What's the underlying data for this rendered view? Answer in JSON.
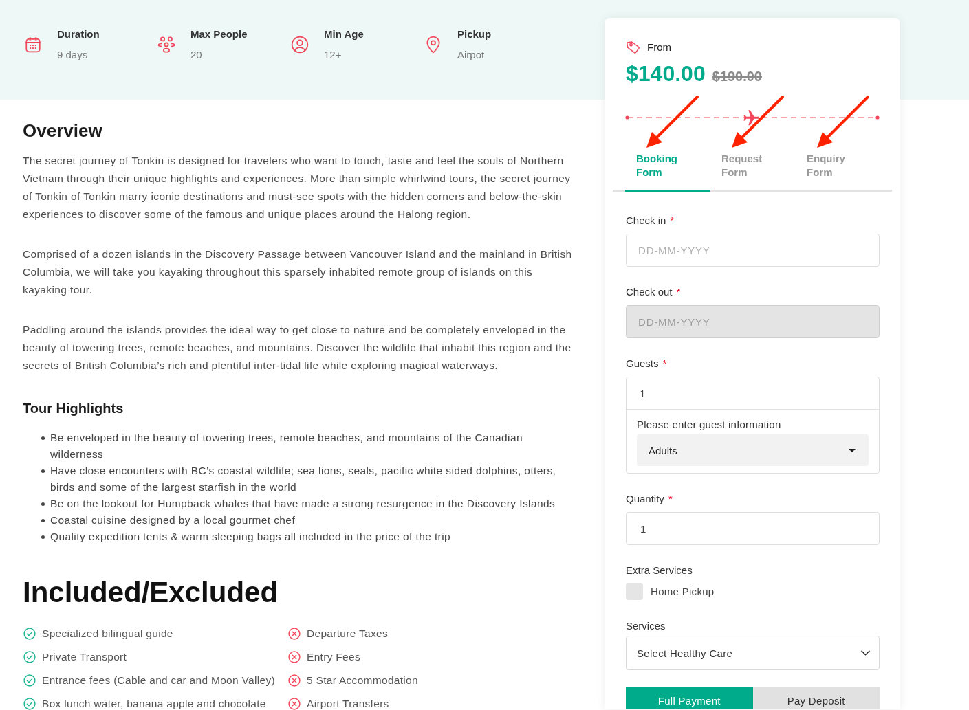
{
  "trip_facts": [
    {
      "kind": "duration",
      "label": "Duration",
      "value": "9 days"
    },
    {
      "kind": "capacity",
      "label": "Max People",
      "value": "20"
    },
    {
      "kind": "age",
      "label": "Min Age",
      "value": "12+"
    },
    {
      "kind": "location",
      "label": "Pickup",
      "value": "Airpot"
    }
  ],
  "overview": {
    "title": "Overview",
    "paragraphs": [
      "The secret journey of Tonkin is designed for travelers who want to touch, taste and feel the souls of Northern Vietnam through their unique highlights and experiences. More than simple whirlwind tours, the secret journey of Tonkin of Tonkin marry iconic destinations and must-see spots with the hidden corners and below-the-skin experiences to discover some of the famous and unique places around the Halong region.",
      "Comprised of a dozen islands in the Discovery Passage between Vancouver Island and the mainland in British Columbia, we will take you kayaking throughout this sparsely inhabited remote group of islands on this kayaking tour.",
      "Paddling around the islands provides the ideal way to get close to nature and be completely enveloped in the beauty of towering trees, remote beaches, and mountains. Discover the wildlife that inhabit this region and the secrets of British Columbia’s rich and plentiful inter-tidal life while exploring magical waterways."
    ]
  },
  "tour_highlights": {
    "title": "Tour Highlights",
    "items": [
      "Be enveloped in the beauty of towering trees, remote beaches, and mountains of the Canadian wilderness",
      "Have close encounters with BC’s coastal wildlife; sea lions, seals, pacific white sided dolphins, otters, birds and some of the largest starfish in the world",
      "Be on the lookout for Humpback whales that have made a strong resurgence in the Discovery Islands",
      "Coastal cuisine designed by a local gourmet chef",
      "Quality expedition tents & warm sleeping bags all included in the price of the trip"
    ]
  },
  "included_excluded": {
    "title": "Included/Excluded",
    "included": [
      "Specialized bilingual guide",
      "Private Transport",
      "Entrance fees (Cable and car and Moon Valley)",
      "Box lunch water, banana apple and chocolate"
    ],
    "excluded": [
      "Departure Taxes",
      "Entry Fees",
      "5 Star Accommodation",
      "Airport Transfers"
    ]
  },
  "booking": {
    "price_label": "From",
    "price": "$140.00",
    "old_price": "$190.00",
    "tabs": [
      {
        "label": "Booking Form",
        "selected": true,
        "annotated": true
      },
      {
        "label": "Request Form",
        "selected": false,
        "annotated": true
      },
      {
        "label": "Enquiry Form",
        "selected": false,
        "annotated": true
      }
    ],
    "fields": [
      {
        "kind": "date",
        "label": "Check in",
        "required_mark": "*",
        "placeholder": "DD-MM-YYYY",
        "disabled": false
      },
      {
        "kind": "date",
        "label": "Check out",
        "required_mark": "*",
        "placeholder": "DD-MM-YYYY",
        "disabled": true
      },
      {
        "kind": "guests",
        "label": "Guests",
        "required_mark": "*",
        "value": "1",
        "hint": "Please enter guest information",
        "guest_type": "Adults"
      },
      {
        "kind": "number",
        "label": "Quantity",
        "required_mark": "*",
        "value": "1"
      },
      {
        "kind": "checkboxes",
        "label": "Extra Services",
        "options": [
          {
            "label": "Home Pickup",
            "checked": false
          }
        ]
      },
      {
        "kind": "select",
        "label": "Services",
        "value": "Select Healthy Care"
      }
    ],
    "payment_options": [
      {
        "label": "Full Payment",
        "selected": true
      },
      {
        "label": "Pay Deposit",
        "selected": false
      }
    ]
  }
}
